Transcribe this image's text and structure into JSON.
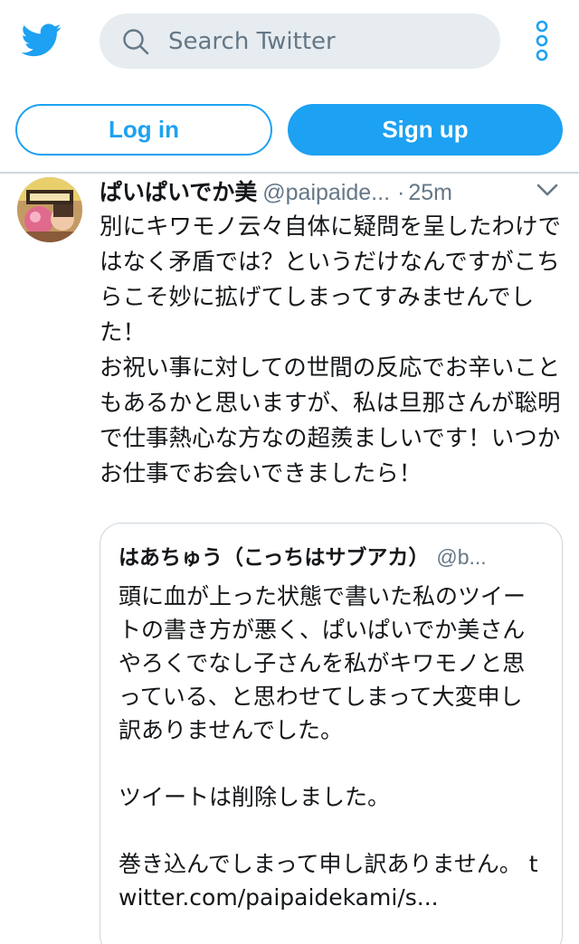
{
  "header": {
    "search_placeholder": "Search Twitter",
    "logo_icon": "twitter-bird-icon",
    "search_icon": "search-icon",
    "more_icon": "more-vertical-icon"
  },
  "auth": {
    "login_label": "Log in",
    "signup_label": "Sign up"
  },
  "tweet": {
    "display_name": "ぱいぱいでか美",
    "handle": "@paipaide...",
    "separator": "·",
    "time": "25m",
    "text": "別にキワモノ云々自体に疑問を呈したわけではなく矛盾では？というだけなんですがこちらこそ妙に拡げてしまってすみませんでした！\nお祝い事に対しての世間の反応でお辛いこともあるかと思いますが、私は旦那さんが聡明で仕事熱心な方なの超羨ましいです！いつかお仕事でお会いできましたら！"
  },
  "quoted_tweet": {
    "display_name": "はあちゅう（こっちはサブアカ）",
    "handle": "@b...",
    "text": "頭に血が上った状態で書いた私のツイートの書き方が悪く、ぱいぱいでか美さんやろくでなし子さんを私がキワモノと思っている、と思わせてしまって大変申し訳ありませんでした。\n\nツイートは削除しました。\n\n巻き込んでしまって申し訳ありません。 twitter.com/paipaidekami/s..."
  },
  "colors": {
    "brand": "#1da1f2",
    "secondary_text": "#657786",
    "search_bg": "#e6ecf0"
  }
}
